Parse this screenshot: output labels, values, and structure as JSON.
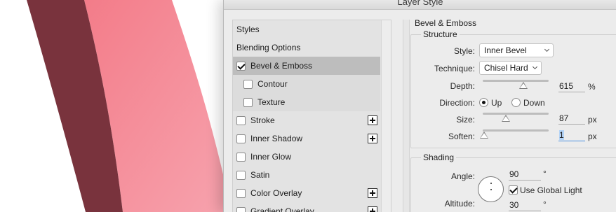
{
  "window": {
    "title": "Layer Style"
  },
  "colors": {
    "shape_dark": "#79333d",
    "shape_light": "#f59aa5",
    "selected_row": "#bdbdbd",
    "focus_blue": "#4a90e2"
  },
  "style_list": {
    "items": [
      {
        "label": "Styles",
        "checkbox": false
      },
      {
        "label": "Blending Options",
        "checkbox": false
      },
      {
        "label": "Bevel & Emboss",
        "checkbox": true,
        "checked": true,
        "selected": true
      },
      {
        "label": "Contour",
        "checkbox": true,
        "checked": false,
        "sub": true
      },
      {
        "label": "Texture",
        "checkbox": true,
        "checked": false,
        "sub": true
      },
      {
        "label": "Stroke",
        "checkbox": true,
        "checked": false,
        "add": true
      },
      {
        "label": "Inner Shadow",
        "checkbox": true,
        "checked": false,
        "add": true
      },
      {
        "label": "Inner Glow",
        "checkbox": true,
        "checked": false
      },
      {
        "label": "Satin",
        "checkbox": true,
        "checked": false
      },
      {
        "label": "Color Overlay",
        "checkbox": true,
        "checked": false,
        "add": true
      },
      {
        "label": "Gradient Overlay",
        "checkbox": true,
        "checked": false,
        "add": true
      }
    ]
  },
  "bevel": {
    "title": "Bevel & Emboss",
    "structure": {
      "title": "Structure",
      "style_label": "Style:",
      "style_value": "Inner Bevel",
      "technique_label": "Technique:",
      "technique_value": "Chisel Hard",
      "depth_label": "Depth:",
      "depth_value": "615",
      "depth_unit": "%",
      "depth_slider": 0.62,
      "direction_label": "Direction:",
      "direction_up": "Up",
      "direction_down": "Down",
      "direction_selected": "Up",
      "size_label": "Size:",
      "size_value": "87",
      "size_unit": "px",
      "size_slider": 0.35,
      "soften_label": "Soften:",
      "soften_value": "1",
      "soften_unit": "px",
      "soften_slider": 0.02
    },
    "shading": {
      "title": "Shading",
      "angle_label": "Angle:",
      "angle_value": "90",
      "angle_unit": "°",
      "global_light_label": "Use Global Light",
      "global_light_checked": true,
      "altitude_label": "Altitude:",
      "altitude_value": "30",
      "altitude_unit": "°"
    }
  }
}
